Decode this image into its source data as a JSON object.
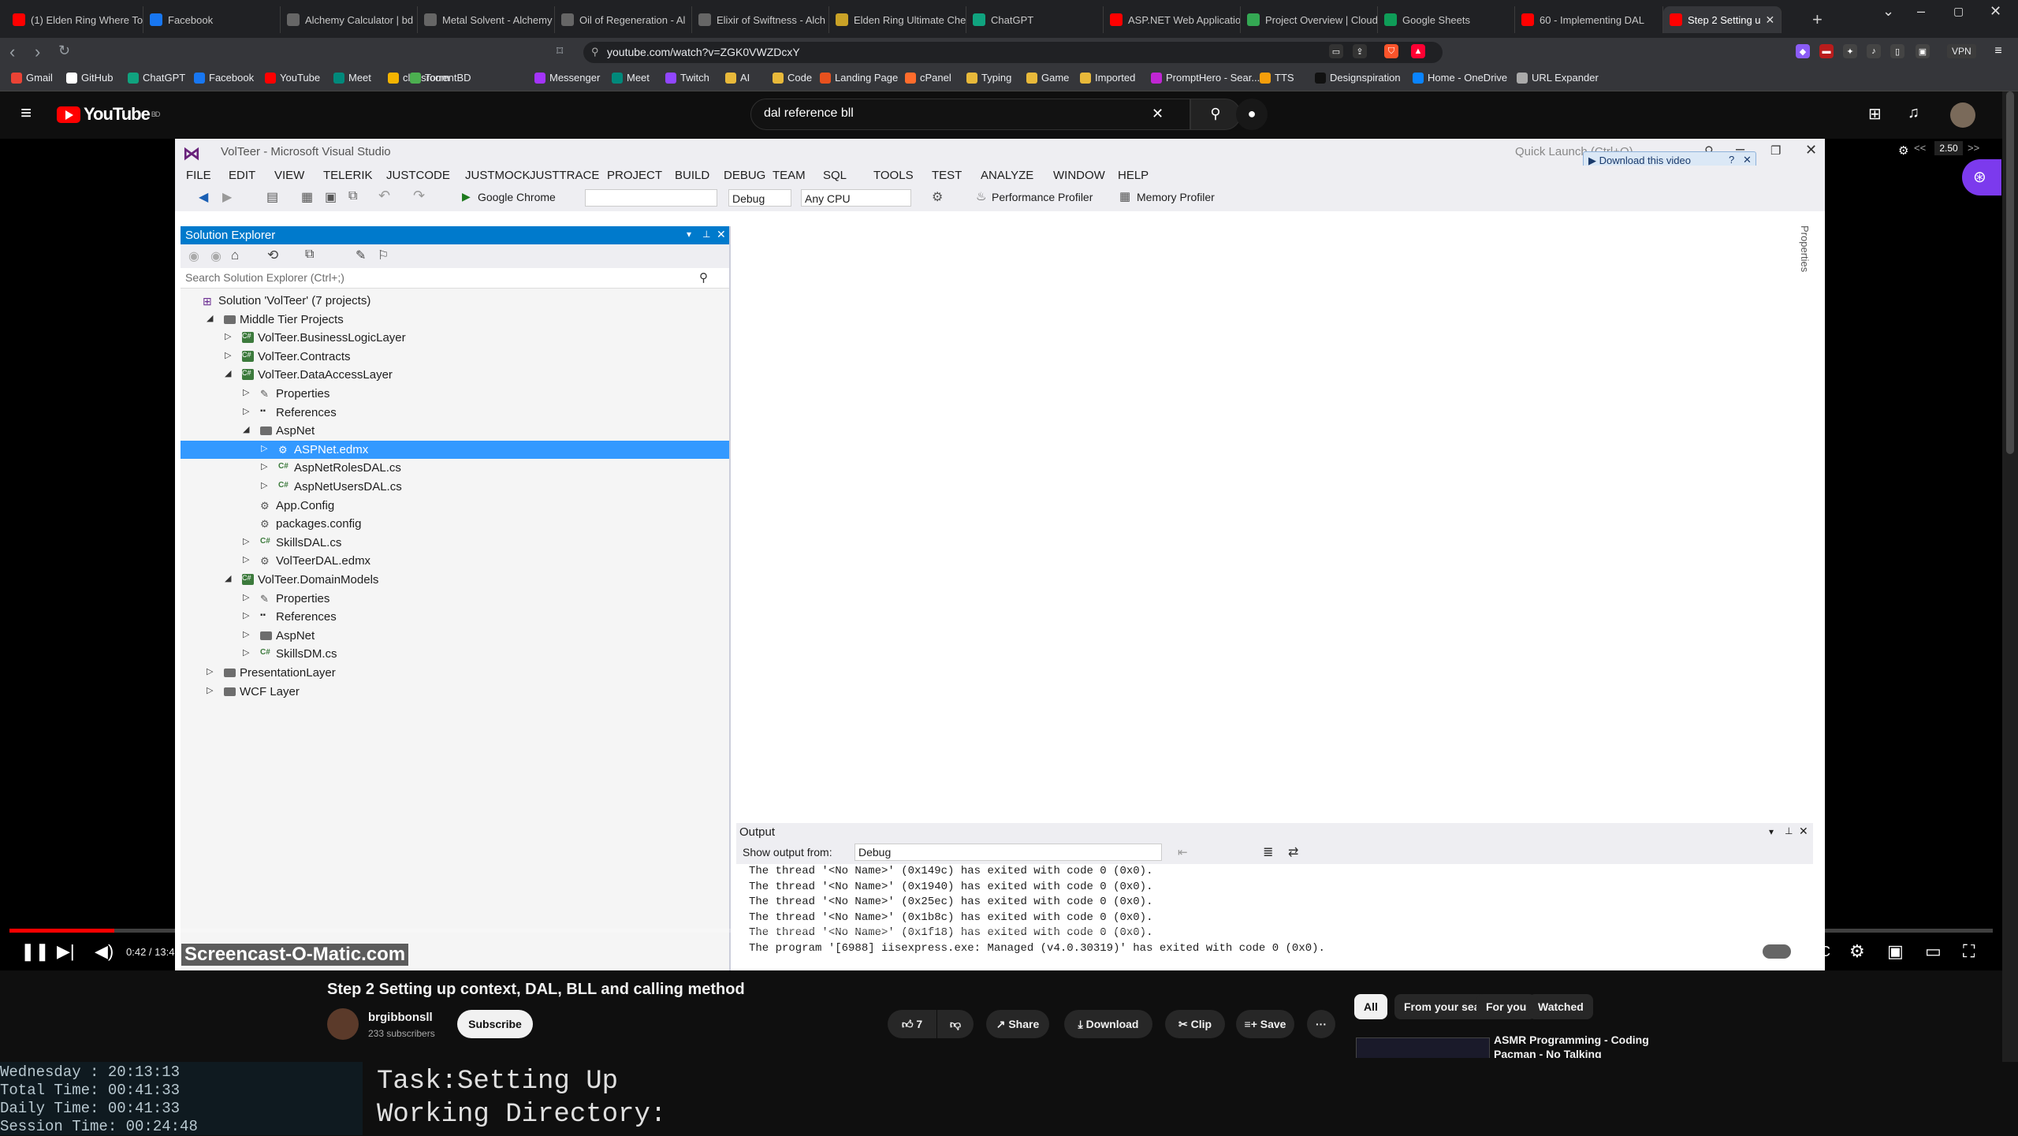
{
  "browser": {
    "tabs": [
      {
        "label": "(1) Elden Ring Where To",
        "color": "#ff0000"
      },
      {
        "label": "Facebook",
        "color": "#1877f2"
      },
      {
        "label": "Alchemy Calculator | bd",
        "color": "#666666"
      },
      {
        "label": "Metal Solvent - Alchemy",
        "color": "#666666"
      },
      {
        "label": "Oil of Regeneration - Al",
        "color": "#666666"
      },
      {
        "label": "Elixir of Swiftness - Alch",
        "color": "#666666"
      },
      {
        "label": "Elden Ring Ultimate Che",
        "color": "#c9a227"
      },
      {
        "label": "ChatGPT",
        "color": "#10a37f"
      },
      {
        "label": "ASP.NET Web Applicatio",
        "color": "#ff0000"
      },
      {
        "label": "Project Overview | Cloud",
        "color": "#34a853"
      },
      {
        "label": "Google Sheets",
        "color": "#0f9d58"
      },
      {
        "label": "60 - Implementing DAL",
        "color": "#ff0000"
      },
      {
        "label": "Step 2 Setting u",
        "color": "#ff0000"
      }
    ],
    "active_tab_close": "✕",
    "new_tab": "+",
    "url": "youtube.com/watch?v=ZGK0VWZDcxY",
    "vpn_label": "VPN",
    "bookmarks": [
      {
        "label": "Gmail",
        "color": "#ea4335"
      },
      {
        "label": "GitHub",
        "color": "#ffffff"
      },
      {
        "label": "ChatGPT",
        "color": "#10a37f"
      },
      {
        "label": "Facebook",
        "color": "#1877f2"
      },
      {
        "label": "YouTube",
        "color": "#ff0000"
      },
      {
        "label": "Meet",
        "color": "#00897b"
      },
      {
        "label": "classroom",
        "color": "#f4b400"
      },
      {
        "label": "TorrentBD",
        "color": "#4caf50"
      },
      {
        "label": "Messenger",
        "color": "#a334fa"
      },
      {
        "label": "Meet",
        "color": "#00897b"
      },
      {
        "label": "Twitch",
        "color": "#9146ff"
      },
      {
        "label": "AI",
        "color": "#e8b93a"
      },
      {
        "label": "Code",
        "color": "#e8b93a"
      },
      {
        "label": "Landing Page",
        "color": "#e8511e"
      },
      {
        "label": "cPanel",
        "color": "#ff6c2c"
      },
      {
        "label": "Typing",
        "color": "#e8b93a"
      },
      {
        "label": "Game",
        "color": "#e8b93a"
      },
      {
        "label": "Imported",
        "color": "#e8b93a"
      },
      {
        "label": "PromptHero - Sear...",
        "color": "#c026d3"
      },
      {
        "label": "TTS",
        "color": "#f59e0b"
      },
      {
        "label": "Designspiration",
        "color": "#111111"
      },
      {
        "label": "Home - OneDrive",
        "color": "#0a84ff"
      },
      {
        "label": "URL Expander",
        "color": "#aaaaaa"
      }
    ]
  },
  "youtube": {
    "logo": "YouTube",
    "logo_country": "BD",
    "search_query": "dal reference bll",
    "video_title": "Step 2 Setting up context, DAL, BLL and calling method",
    "channel": "brgibbonsll",
    "subscribers": "233 subscribers",
    "subscribe_label": "Subscribe",
    "likes": "7",
    "share_label": "Share",
    "download_label": "Download",
    "clip_label": "Clip",
    "save_label": "Save",
    "more_label": "···",
    "time_readout": "0:42 / 13:4",
    "speed": "2.50",
    "progress_fraction": 0.053,
    "chips": [
      "All",
      "From your search",
      "For you",
      "Watched"
    ],
    "rec_title": "ASMR Programming - Coding Pacman - No Talking",
    "watermark": "Screencast-O-Matic.com"
  },
  "vs": {
    "title": "VolTeer - Microsoft Visual Studio",
    "quick_launch": "Quick Launch (Ctrl+Q)",
    "download_video": "Download this video",
    "menu": [
      "FILE",
      "EDIT",
      "VIEW",
      "TELERIK",
      "JUSTCODE",
      "JUSTMOCK",
      "JUSTTRACE",
      "PROJECT",
      "BUILD",
      "DEBUG",
      "TEAM",
      "SQL",
      "TOOLS",
      "TEST",
      "ANALYZE",
      "WINDOW",
      "HELP"
    ],
    "run_target": "Google Chrome",
    "config": "Debug",
    "platform": "Any CPU",
    "perf_profiler": "Performance Profiler",
    "mem_profiler": "Memory Profiler",
    "solution_explorer": {
      "title": "Solution Explorer",
      "search_placeholder": "Search Solution Explorer (Ctrl+;)",
      "items": [
        {
          "label": "Solution 'VolTeer' (7 projects)"
        },
        {
          "label": "Middle Tier Projects"
        },
        {
          "label": "VolTeer.BusinessLogicLayer"
        },
        {
          "label": "VolTeer.Contracts"
        },
        {
          "label": "VolTeer.DataAccessLayer"
        },
        {
          "label": "Properties"
        },
        {
          "label": "References"
        },
        {
          "label": "AspNet"
        },
        {
          "label": "ASPNet.edmx"
        },
        {
          "label": "AspNetRolesDAL.cs"
        },
        {
          "label": "AspNetUsersDAL.cs"
        },
        {
          "label": "App.Config"
        },
        {
          "label": "packages.config"
        },
        {
          "label": "SkillsDAL.cs"
        },
        {
          "label": "VolTeerDAL.edmx"
        },
        {
          "label": "VolTeer.DomainModels"
        },
        {
          "label": "Properties"
        },
        {
          "label": "References"
        },
        {
          "label": "AspNet"
        },
        {
          "label": "SkillsDM.cs"
        },
        {
          "label": "PresentationLayer"
        },
        {
          "label": "WCF Layer"
        }
      ]
    },
    "properties_label": "Properties",
    "output": {
      "title": "Output",
      "show_from_label": "Show output from:",
      "source": "Debug",
      "lines": [
        "The thread '<No Name>' (0x149c) has exited with code 0 (0x0).",
        "The thread '<No Name>' (0x1940) has exited with code 0 (0x0).",
        "The thread '<No Name>' (0x25ec) has exited with code 0 (0x0).",
        "The thread '<No Name>' (0x1b8c) has exited with code 0 (0x0).",
        "The thread '<No Name>' (0x1f18) has exited with code 0 (0x0).",
        "The program '[6988] iisexpress.exe: Managed (v4.0.30319)' has exited with code 0 (0x0)."
      ]
    }
  },
  "terminal": {
    "left_lines": [
      "Wednesday  :  20:13:13",
      "Total Time: 00:41:33",
      "Daily Time: 00:41:33",
      "Session Time: 00:24:48"
    ],
    "task": "Task:Setting Up",
    "working_dir": "Working Directory:"
  }
}
